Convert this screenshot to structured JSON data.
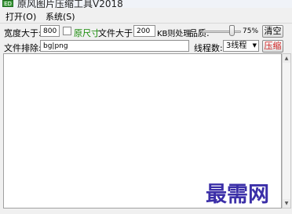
{
  "window": {
    "title": "原风图片压缩工具V2018",
    "icon_name": "app-icon",
    "icon_text": "ED"
  },
  "menu": {
    "items": [
      {
        "label": "打开(O)"
      },
      {
        "label": "系统(S)"
      }
    ]
  },
  "settings": {
    "width_label": "宽度大于:",
    "width_value": "800",
    "original_size_label": "原尺寸",
    "original_size_checked": false,
    "file_size_label": "文件大于:",
    "file_size_value": "200",
    "kb_label": "KB则处理",
    "quality_label": "品质:",
    "quality_percent": 75,
    "quality_text": "75%",
    "clear_button": "清空"
  },
  "exclude": {
    "label": "文件排除:",
    "value": "bg|png",
    "threads_label": "线程数:",
    "threads_value": "3线程",
    "compress_button": "压缩"
  },
  "output_log": "",
  "watermark": "最需网",
  "colors": {
    "green_label": "#118800",
    "compress_text": "#d02020",
    "watermark": "#3b2fa8"
  }
}
